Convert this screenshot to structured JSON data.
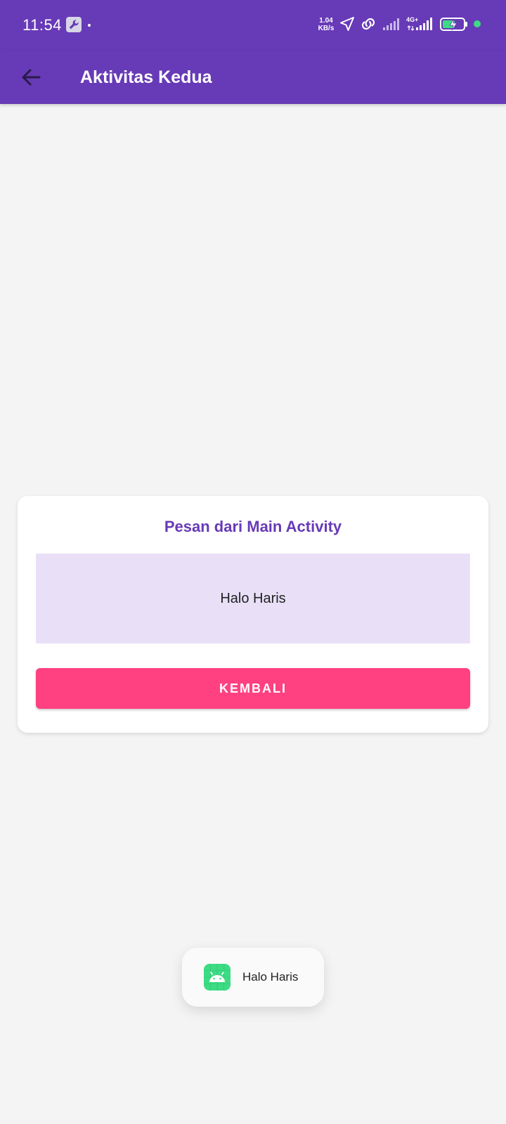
{
  "status_bar": {
    "time": "11:54",
    "net_speed_value": "1.04",
    "net_speed_unit": "KB/s",
    "network_type": "4G+",
    "icons": [
      "wrench-icon",
      "location-arrow-icon",
      "link-icon",
      "signal-icon",
      "signal-4g-icon",
      "battery-charging-icon"
    ],
    "accent_dot_color": "#3ddc84"
  },
  "app_bar": {
    "title": "Aktivitas Kedua",
    "back_icon": "arrow-back-icon",
    "background_color": "#673ab7"
  },
  "card": {
    "title": "Pesan dari Main Activity",
    "message": "Halo Haris",
    "button_label": "KEMBALI",
    "title_color": "#673ab7",
    "message_background": "#e9e0f8",
    "button_color": "#ff4081"
  },
  "toast": {
    "icon": "android-app-icon",
    "message": "Halo Haris"
  }
}
